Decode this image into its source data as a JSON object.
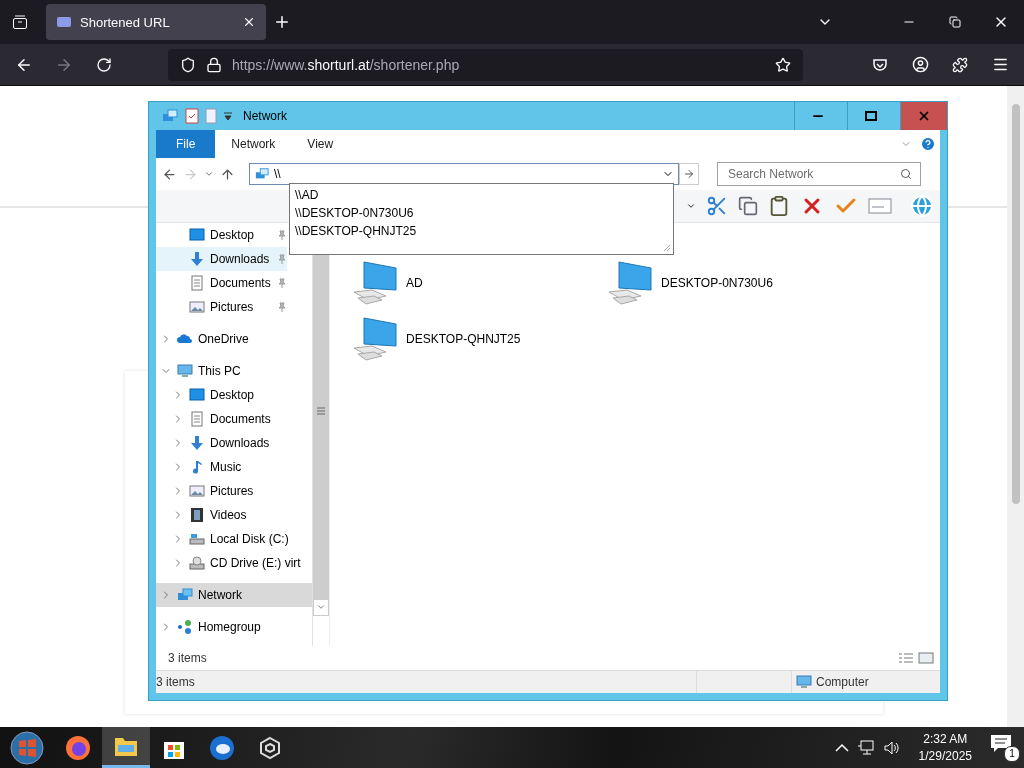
{
  "browser": {
    "tab": {
      "title": "Shortened URL"
    },
    "url": "https://www.**shorturl.at**/shortener.php"
  },
  "explorer": {
    "title": "Network",
    "ribbon_tabs": [
      {
        "label": "File",
        "selected": true
      },
      {
        "label": "Network",
        "selected": false
      },
      {
        "label": "View",
        "selected": false
      }
    ],
    "address": {
      "value": "\\\\"
    },
    "search": {
      "placeholder": "Search Network"
    },
    "suggestions": [
      "\\\\AD",
      "\\\\DESKTOP-0N730U6",
      "\\\\DESKTOP-QHNJT25"
    ],
    "quick_access": [
      {
        "label": "Desktop",
        "kind": "desktop",
        "hovered": false
      },
      {
        "label": "Downloads",
        "kind": "downloads",
        "hovered": true
      },
      {
        "label": "Documents",
        "kind": "documents",
        "hovered": false
      },
      {
        "label": "Pictures",
        "kind": "pictures",
        "hovered": false
      }
    ],
    "tree": [
      {
        "label": "OneDrive",
        "kind": "onedrive",
        "expanded": false,
        "selected": false
      },
      {
        "label": "This PC",
        "kind": "pc",
        "expanded": true,
        "selected": false,
        "children": [
          {
            "label": "Desktop",
            "kind": "desktop",
            "expanded": false,
            "selected": false
          },
          {
            "label": "Documents",
            "kind": "documents",
            "expanded": false,
            "selected": false
          },
          {
            "label": "Downloads",
            "kind": "downloads",
            "expanded": false,
            "selected": false
          },
          {
            "label": "Music",
            "kind": "music",
            "expanded": false,
            "selected": false
          },
          {
            "label": "Pictures",
            "kind": "pictures",
            "expanded": false,
            "selected": false
          },
          {
            "label": "Videos",
            "kind": "videos",
            "expanded": false,
            "selected": false
          },
          {
            "label": "Local Disk (C:)",
            "kind": "disk",
            "expanded": false,
            "selected": false
          },
          {
            "label": "CD Drive (E:) virt",
            "kind": "cd",
            "expanded": false,
            "selected": false
          }
        ]
      },
      {
        "label": "Network",
        "kind": "network",
        "expanded": false,
        "selected": true
      },
      {
        "label": "Homegroup",
        "kind": "homegroup",
        "expanded": false,
        "selected": false
      }
    ],
    "items": [
      {
        "name": "AD"
      },
      {
        "name": "DESKTOP-0N730U6"
      },
      {
        "name": "DESKTOP-QHNJT25"
      }
    ],
    "item_count": "3 items",
    "status": {
      "count": "3 items",
      "location": "Computer"
    }
  },
  "taskbar": {
    "time": "2:32 AM",
    "date": "1/29/2025",
    "notifications": "1"
  }
}
